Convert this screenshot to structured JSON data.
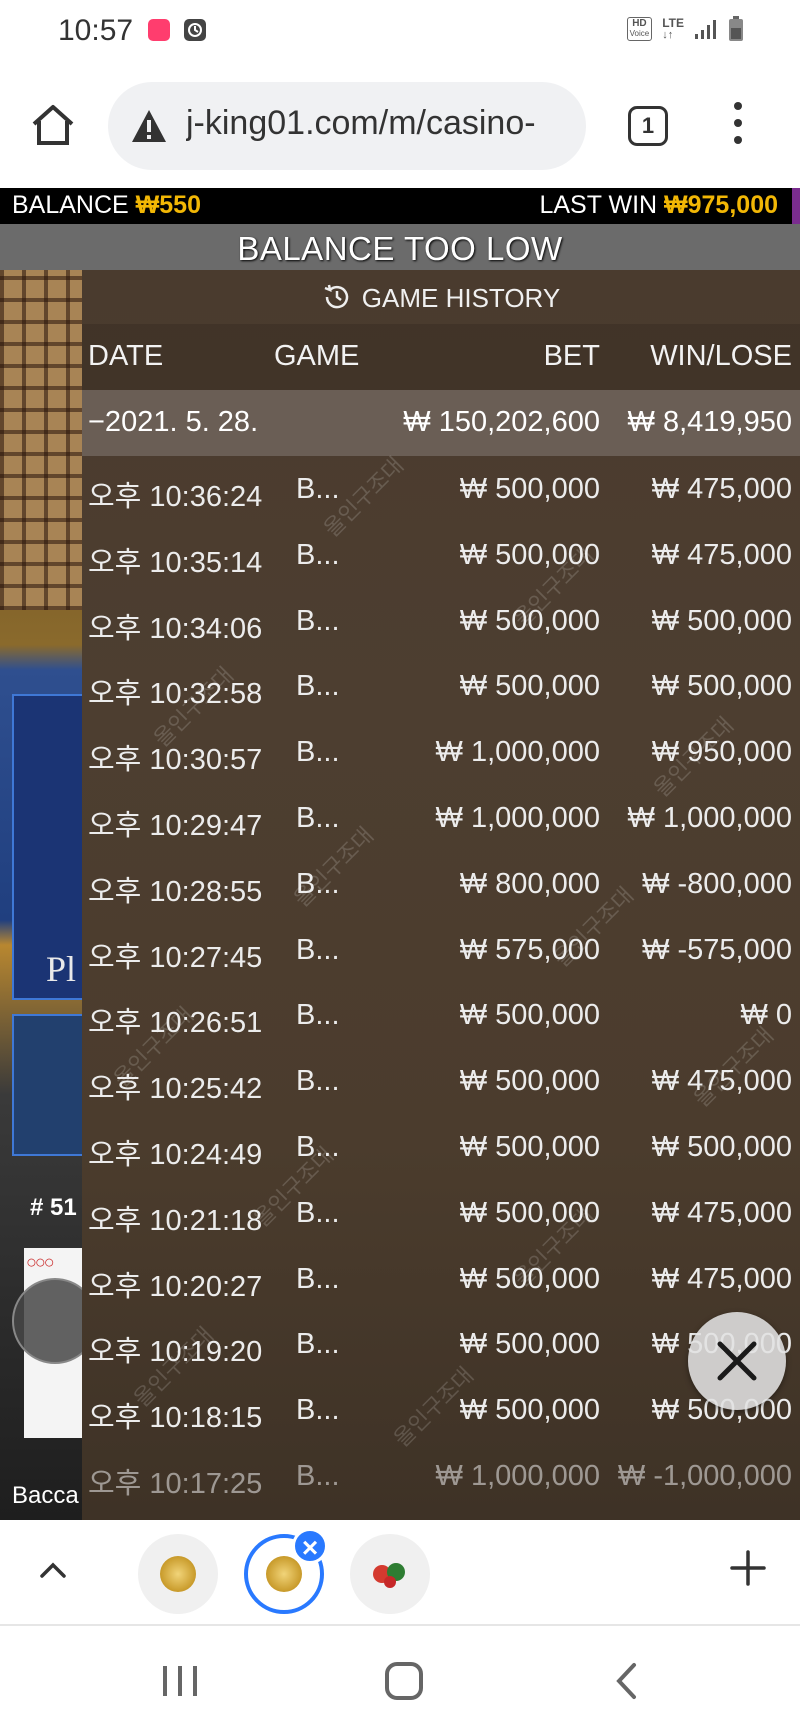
{
  "status_bar": {
    "time": "10:57",
    "hd_label": "HD",
    "voice_label": "Voice",
    "lte_label": "LTE"
  },
  "browser": {
    "url": "j-king01.com/m/casino-",
    "tab_count": "1"
  },
  "game": {
    "balance_label": "BALANCE",
    "balance_value": "₩550",
    "last_win_label": "LAST WIN",
    "last_win_value": "₩975,000",
    "banner": "BALANCE TOO LOW",
    "background_hash": "# 51",
    "background_letters": "Pl",
    "background_label": "Bacca"
  },
  "history": {
    "title": "GAME HISTORY",
    "columns": {
      "date": "DATE",
      "game": "GAME",
      "bet": "BET",
      "winlose": "WIN/LOSE"
    },
    "summary": {
      "date": "−2021. 5. 28.",
      "bet": "₩ 150,202,600",
      "winlose": "₩ 8,419,950"
    },
    "rows": [
      {
        "time": "오후 10:36:24",
        "game": "B...",
        "bet": "₩ 500,000",
        "winlose": "₩ 475,000"
      },
      {
        "time": "오후 10:35:14",
        "game": "B...",
        "bet": "₩ 500,000",
        "winlose": "₩ 475,000"
      },
      {
        "time": "오후 10:34:06",
        "game": "B...",
        "bet": "₩ 500,000",
        "winlose": "₩ 500,000"
      },
      {
        "time": "오후 10:32:58",
        "game": "B...",
        "bet": "₩ 500,000",
        "winlose": "₩ 500,000"
      },
      {
        "time": "오후 10:30:57",
        "game": "B...",
        "bet": "₩ 1,000,000",
        "winlose": "₩ 950,000"
      },
      {
        "time": "오후 10:29:47",
        "game": "B...",
        "bet": "₩ 1,000,000",
        "winlose": "₩ 1,000,000"
      },
      {
        "time": "오후 10:28:55",
        "game": "B...",
        "bet": "₩ 800,000",
        "winlose": "₩ -800,000"
      },
      {
        "time": "오후 10:27:45",
        "game": "B...",
        "bet": "₩ 575,000",
        "winlose": "₩ -575,000"
      },
      {
        "time": "오후 10:26:51",
        "game": "B...",
        "bet": "₩ 500,000",
        "winlose": "₩ 0"
      },
      {
        "time": "오후 10:25:42",
        "game": "B...",
        "bet": "₩ 500,000",
        "winlose": "₩ 475,000"
      },
      {
        "time": "오후 10:24:49",
        "game": "B...",
        "bet": "₩ 500,000",
        "winlose": "₩ 500,000"
      },
      {
        "time": "오후 10:21:18",
        "game": "B...",
        "bet": "₩ 500,000",
        "winlose": "₩ 475,000"
      },
      {
        "time": "오후 10:20:27",
        "game": "B...",
        "bet": "₩ 500,000",
        "winlose": "₩ 475,000"
      },
      {
        "time": "오후 10:19:20",
        "game": "B...",
        "bet": "₩ 500,000",
        "winlose": "₩ 500,000"
      },
      {
        "time": "오후 10:18:15",
        "game": "B...",
        "bet": "₩ 500,000",
        "winlose": "₩ 500,000"
      },
      {
        "time": "오후 10:17:25",
        "game": "B...",
        "bet": "₩ 1,000,000",
        "winlose": "₩ -1,000,000"
      }
    ],
    "watermark": "올인구조대"
  },
  "colors": {
    "gold": "#f2b705",
    "tab_accent": "#2979ff",
    "panel_bg": "#4a3b2e"
  }
}
